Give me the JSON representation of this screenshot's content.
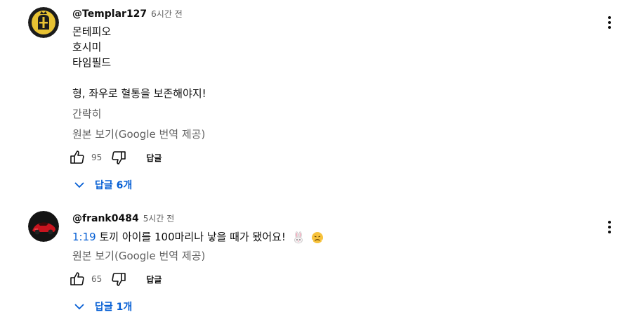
{
  "comments": [
    {
      "author": "@Templar127",
      "time": "6시간 전",
      "lines": [
        "몬테피오",
        "호시미",
        "타임필드",
        "",
        "형, 좌우로 혈통을 보존해야지!"
      ],
      "translation": "간략히",
      "view_original": "원본 보기(Google 번역 제공)",
      "likes": "95",
      "reply_label": "답글",
      "replies_label": "답글 6개",
      "avatar_icon": "templar-helmet-icon"
    },
    {
      "author": "@frank0484",
      "time": "5시간 전",
      "timestamp": "1:19",
      "text": " 토끼 아이를 100마리나 낳을 때가 됐어요!",
      "emojis": [
        "rabbit-icon",
        "frustrated-face-icon"
      ],
      "view_original": "원본 보기(Google 번역 제공)",
      "likes": "65",
      "reply_label": "답글",
      "replies_label": "답글 1개",
      "avatar_icon": "red-car-icon"
    }
  ],
  "colors": {
    "accent": "#065fd4",
    "secondary_text": "#606060",
    "primary_text": "#0f0f0f"
  }
}
